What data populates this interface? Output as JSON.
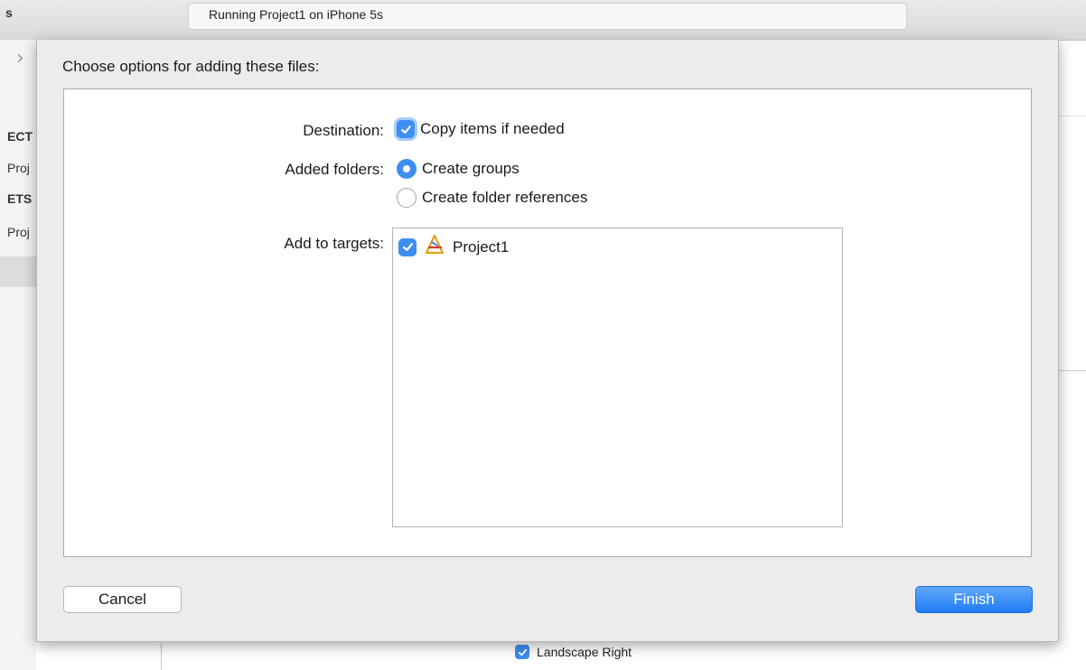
{
  "toolbar": {
    "left_fragment": "s",
    "activity_text": "Running Project1 on iPhone 5s"
  },
  "navigator": {
    "items": [
      {
        "label": "ECT",
        "bold": true
      },
      {
        "label": "Proj",
        "bold": false
      },
      {
        "label": "ETS",
        "bold": true
      },
      {
        "label": "Proj",
        "bold": false,
        "selected": true
      }
    ]
  },
  "background": {
    "landscape_right_label": "Landscape Right",
    "landscape_right_checked": true
  },
  "sheet": {
    "title": "Choose options for adding these files:",
    "destination": {
      "label": "Destination:",
      "option": "Copy items if needed",
      "checked": true
    },
    "added_folders": {
      "label": "Added folders:",
      "options": [
        "Create groups",
        "Create folder references"
      ],
      "selected": "Create groups"
    },
    "targets": {
      "label": "Add to targets:",
      "items": [
        {
          "name": "Project1",
          "checked": true,
          "icon": "xcode-app-icon"
        }
      ]
    },
    "buttons": {
      "cancel": "Cancel",
      "finish": "Finish"
    }
  },
  "colors": {
    "accent": "#3d8ef0",
    "sheet_bg": "#ececec"
  }
}
